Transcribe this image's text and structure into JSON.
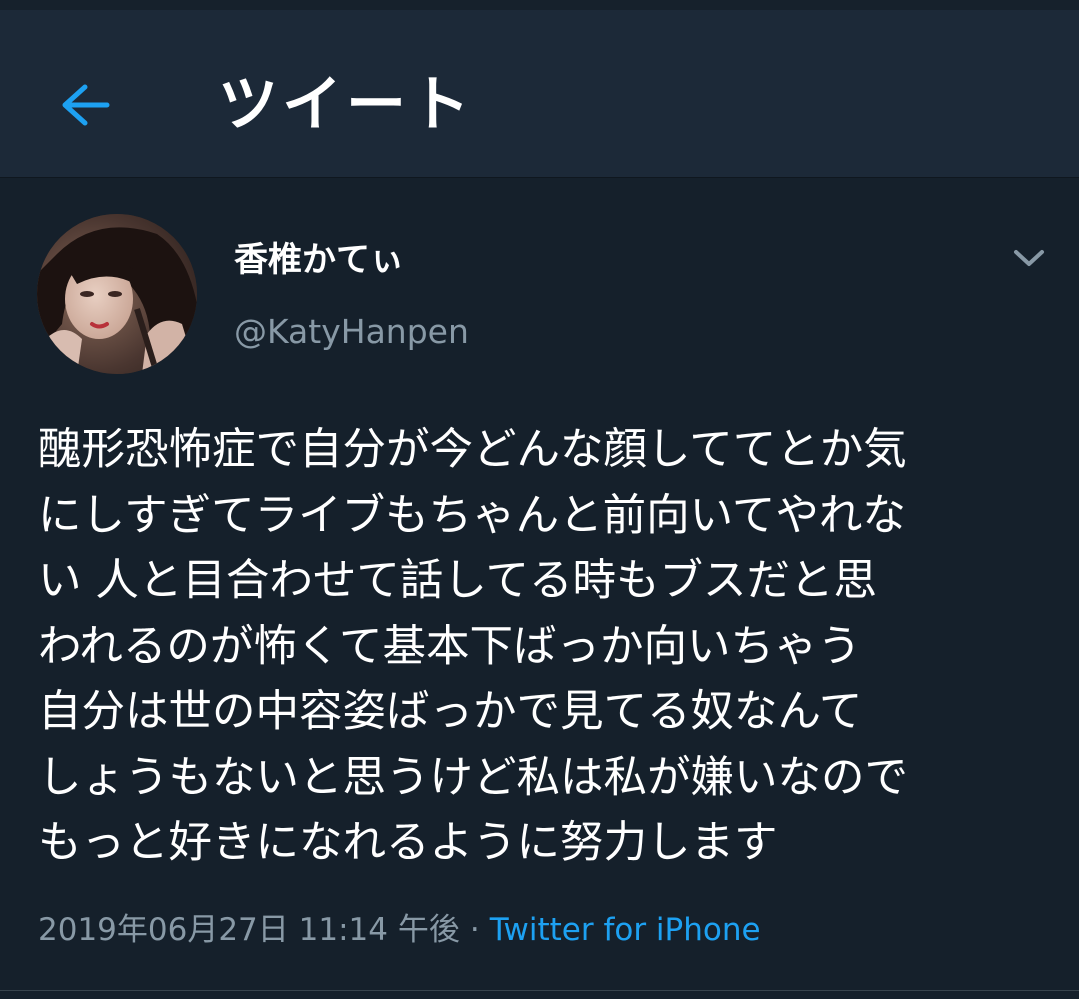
{
  "header": {
    "back_icon": "arrow-left-icon",
    "title": "ツイート"
  },
  "tweet": {
    "avatar_icon": "profile-photo",
    "display_name": "香椎かてぃ",
    "handle": "@KatyHanpen",
    "menu_icon": "chevron-down-icon",
    "text": "醜形恐怖症で自分が今どんな顔しててとか気\nにしすぎてライブもちゃんと前向いてやれな\nい 人と目合わせて話してる時もブスだと思\nわれるのが怖くて基本下ばっか向いちゃう\n自分は世の中容姿ばっかで見てる奴なんて\nしょうもないと思うけど私は私が嫌いなので\nもっと好きになれるように努力します",
    "timestamp": "2019年06月27日 11:14 午後",
    "separator": "·",
    "source": "Twitter for iPhone"
  },
  "colors": {
    "background": "#15202b",
    "header_background": "#1c2938",
    "accent": "#1da1f2",
    "secondary_text": "#8899a6"
  }
}
